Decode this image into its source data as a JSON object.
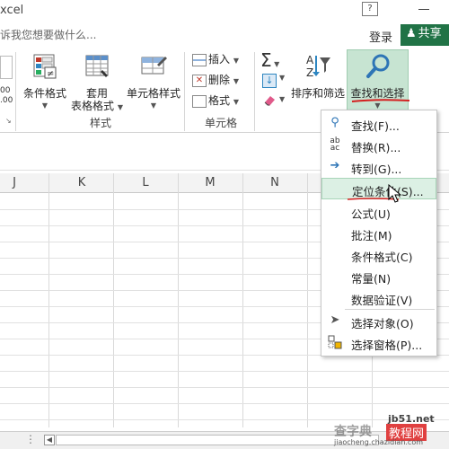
{
  "titlebar": {
    "app_title": "xcel",
    "help": "?"
  },
  "tellme": {
    "placeholder": "诉我您想要做什么..."
  },
  "account": {
    "login": "登录",
    "share": "共享",
    "share_icon": "person-plus-icon"
  },
  "ribbon": {
    "styles_group": {
      "label": "样式",
      "conditional_format": "条件格式",
      "table_format_line1": "套用",
      "table_format_line2": "表格格式",
      "cell_styles": "单元格样式"
    },
    "cells_group": {
      "label": "单元格",
      "insert": "插入",
      "delete": "删除",
      "format": "格式"
    },
    "editing_group": {
      "autosum": "Σ",
      "sort_filter": "排序和筛选",
      "find_select": "查找和选择"
    },
    "number_partial": [
      "00",
      ".00"
    ]
  },
  "columns": [
    "J",
    "K",
    "L",
    "M",
    "N"
  ],
  "menu": {
    "items": [
      {
        "label": "查找(F)...",
        "icon": "search-icon",
        "shortcut": "F"
      },
      {
        "label": "替换(R)...",
        "icon": "replace-icon",
        "shortcut": "R"
      },
      {
        "label": "转到(G)...",
        "icon": "arrow-right-icon",
        "shortcut": "G"
      },
      {
        "label": "定位条件(S)...",
        "icon": "",
        "shortcut": "S"
      },
      {
        "label": "公式(U)",
        "icon": "",
        "shortcut": "U"
      },
      {
        "label": "批注(M)",
        "icon": "",
        "shortcut": "M"
      },
      {
        "label": "条件格式(C)",
        "icon": "",
        "shortcut": "C"
      },
      {
        "label": "常量(N)",
        "icon": "",
        "shortcut": "N"
      },
      {
        "label": "数据验证(V)",
        "icon": "",
        "shortcut": "V"
      },
      {
        "label": "选择对象(O)",
        "icon": "cursor-arrow-icon",
        "shortcut": "O"
      },
      {
        "label": "选择窗格(P)...",
        "icon": "selection-pane-icon",
        "shortcut": "P"
      }
    ],
    "hovered_index": 3
  },
  "watermark": {
    "line1": "查字典",
    "line2": "教程网",
    "site": "jb51.net",
    "url": "jiaocheng.chazidian.com"
  },
  "colors": {
    "accent": "#217346",
    "hover": "#dcf0e4",
    "find_select_bg": "#c7e4d2",
    "underline_red": "#d42020"
  }
}
